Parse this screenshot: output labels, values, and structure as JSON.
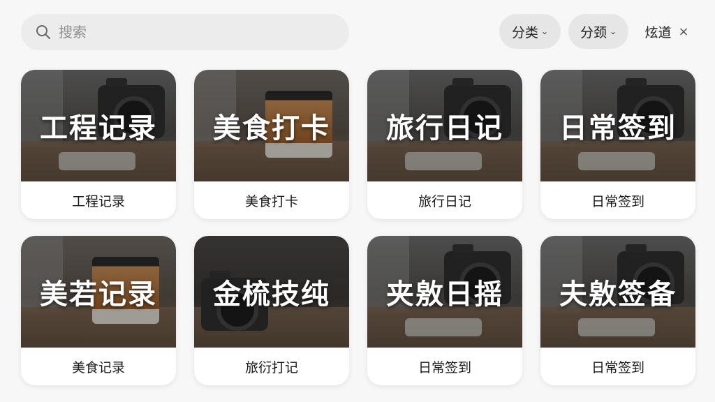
{
  "search": {
    "placeholder": "搜索"
  },
  "filters": [
    {
      "label": "分类",
      "icon": "chevron-down-icon"
    },
    {
      "label": "分颈",
      "icon": "chevron-down-icon"
    },
    {
      "label": "炫道",
      "icon": "close-icon"
    }
  ],
  "cards": [
    {
      "thumb_title": "工程记录",
      "label": "工程记录",
      "image": "camera-on-desk"
    },
    {
      "thumb_title": "美食打卡",
      "label": "美食打卡",
      "image": "food-jar"
    },
    {
      "thumb_title": "旅行日记",
      "label": "旅行日记",
      "image": "camera-on-desk"
    },
    {
      "thumb_title": "日常签到",
      "label": "日常签到",
      "image": "camera-on-desk"
    },
    {
      "thumb_title": "美若记录",
      "label": "美食记录",
      "image": "food-jar"
    },
    {
      "thumb_title": "金梳技纯",
      "label": "旅衍打记",
      "image": "camera-dark"
    },
    {
      "thumb_title": "夹敫日揺",
      "label": "日常签到",
      "image": "camera-on-desk"
    },
    {
      "thumb_title": "夫敫签备",
      "label": "日常签到",
      "image": "camera-on-desk"
    }
  ]
}
